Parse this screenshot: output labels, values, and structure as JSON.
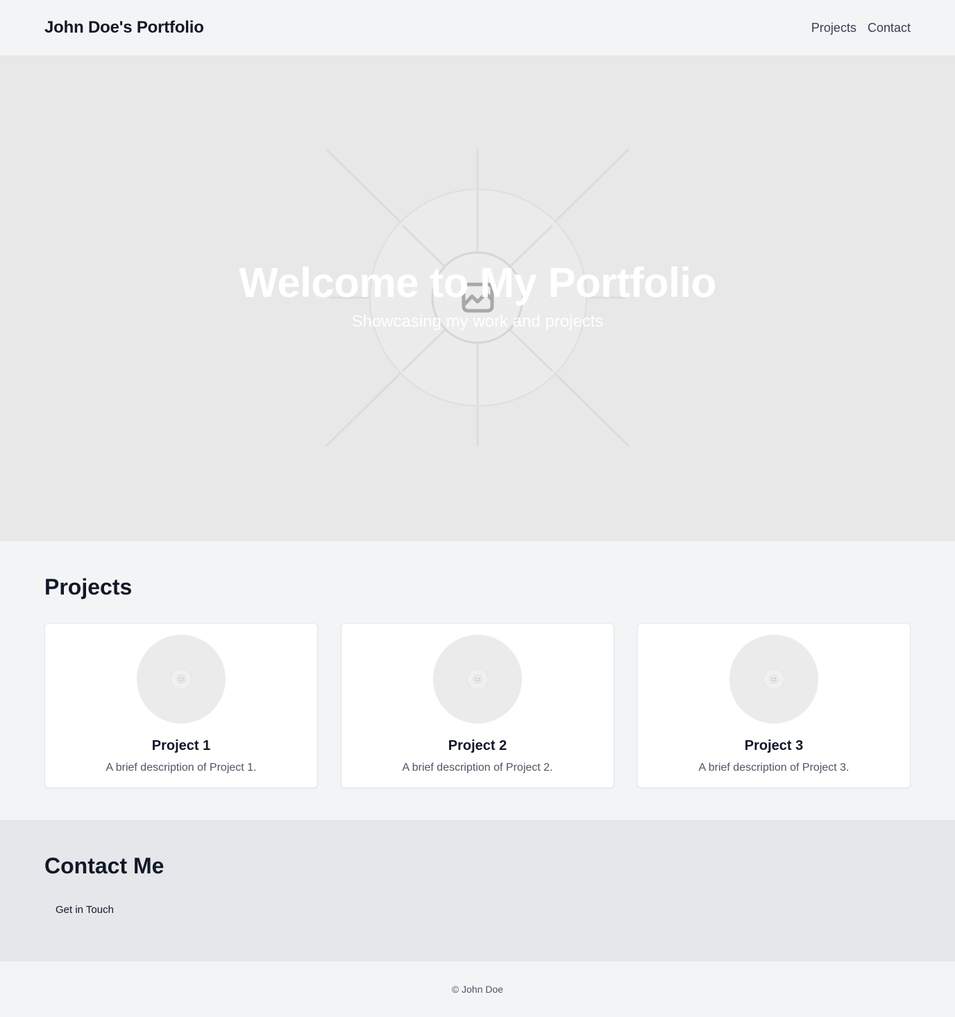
{
  "header": {
    "brand": "John Doe's Portfolio",
    "nav": [
      {
        "label": "Projects"
      },
      {
        "label": "Contact"
      }
    ]
  },
  "hero": {
    "title": "Welcome to My Portfolio",
    "subtitle": "Showcasing my work and projects",
    "image_icon": "image-placeholder-icon"
  },
  "projects": {
    "heading": "Projects",
    "items": [
      {
        "title": "Project 1",
        "description": "A brief description of Project 1.",
        "image_icon": "image-placeholder-icon"
      },
      {
        "title": "Project 2",
        "description": "A brief description of Project 2.",
        "image_icon": "image-placeholder-icon"
      },
      {
        "title": "Project 3",
        "description": "A brief description of Project 3.",
        "image_icon": "image-placeholder-icon"
      }
    ]
  },
  "contact": {
    "heading": "Contact Me",
    "button_label": "Get in Touch"
  },
  "footer": {
    "text": "© John Doe"
  },
  "colors": {
    "page_bg": "#f3f4f6",
    "hero_bg": "#e8e8e8",
    "contact_bg": "#e5e7eb",
    "text_primary": "#111827",
    "text_secondary": "#4b5563"
  }
}
